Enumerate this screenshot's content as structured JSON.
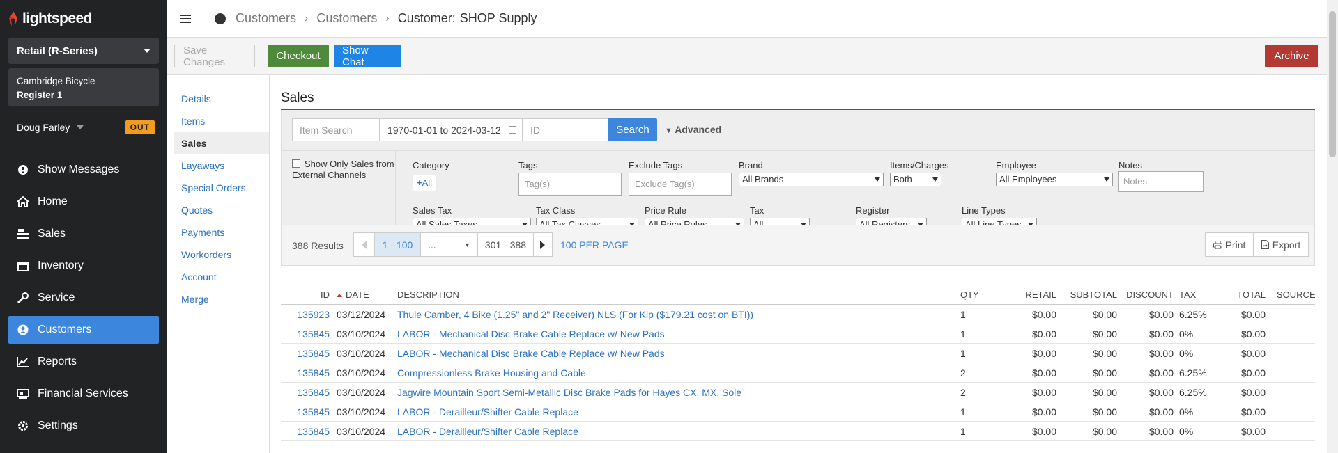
{
  "brand": {
    "name": "lightspeed",
    "accent": "#e8452c"
  },
  "sidebar": {
    "store": "Retail (R-Series)",
    "shop": "Cambridge Bicycle",
    "register": "Register 1",
    "user": "Doug Farley",
    "clock_badge": "OUT",
    "nav": [
      {
        "label": "Show Messages",
        "icon": "info-icon"
      },
      {
        "label": "Home",
        "icon": "home-icon"
      },
      {
        "label": "Sales",
        "icon": "cash-register-icon"
      },
      {
        "label": "Inventory",
        "icon": "barcode-icon"
      },
      {
        "label": "Service",
        "icon": "wrench-icon"
      },
      {
        "label": "Customers",
        "icon": "user-icon",
        "active": true
      },
      {
        "label": "Reports",
        "icon": "chart-line-icon"
      },
      {
        "label": "Financial Services",
        "icon": "bank-icon"
      },
      {
        "label": "Settings",
        "icon": "gear-icon"
      }
    ]
  },
  "header": {
    "breadcrumbs": [
      "Customers",
      "Customers"
    ],
    "current_prefix": "Customer:",
    "current_name": "SHOP Supply"
  },
  "toolbar": {
    "save_label": "Save Changes",
    "checkout_label": "Checkout",
    "chat_label": "Show Chat",
    "archive_label": "Archive"
  },
  "subnav": [
    "Details",
    "Items",
    "Sales",
    "Layaways",
    "Special Orders",
    "Quotes",
    "Payments",
    "Workorders",
    "Account",
    "Merge"
  ],
  "subnav_active": "Sales",
  "main": {
    "title": "Sales"
  },
  "search": {
    "item_placeholder": "Item Search",
    "date_range": "1970-01-01 to 2024-03-12",
    "id_placeholder": "ID",
    "button": "Search",
    "advanced": "Advanced"
  },
  "filters": {
    "external_only_label": "Show Only Sales from External Channels",
    "category_label": "Category",
    "category_button": "All",
    "tags_label": "Tags",
    "tags_placeholder": "Tag(s)",
    "exclude_tags_label": "Exclude Tags",
    "exclude_tags_placeholder": "Exclude Tag(s)",
    "brand_label": "Brand",
    "brand_value": "All Brands",
    "items_charges_label": "Items/Charges",
    "items_charges_value": "Both",
    "employee_label": "Employee",
    "employee_value": "All Employees",
    "notes_label": "Notes",
    "notes_placeholder": "Notes",
    "sales_tax_label": "Sales Tax",
    "sales_tax_value": "All Sales Taxes",
    "tax_class_label": "Tax Class",
    "tax_class_value": "All Tax Classes",
    "price_rule_label": "Price Rule",
    "price_rule_value": "All Price Rules",
    "tax_label": "Tax",
    "tax_value": "All",
    "register_label": "Register",
    "register_value": "All Registers",
    "line_types_label": "Line Types",
    "line_types_value": "All Line Types"
  },
  "results": {
    "count": "388 Results",
    "page_current": "1 - 100",
    "page_ellipsis": "...",
    "page_last": "301 - 388",
    "per_page": "100 PER PAGE",
    "print": "Print",
    "export": "Export"
  },
  "table": {
    "columns": [
      "ID",
      "DATE",
      "DESCRIPTION",
      "QTY",
      "RETAIL",
      "SUBTOTAL",
      "DISCOUNT",
      "TAX",
      "TOTAL",
      "SOURCE"
    ],
    "rows": [
      [
        "135923",
        "03/12/2024",
        "Thule Camber, 4 Bike (1.25\" and 2\" Receiver) NLS (For Kip ($179.21 cost on BTI))",
        "1",
        "$0.00",
        "$0.00",
        "$0.00",
        "6.25%",
        "$0.00",
        ""
      ],
      [
        "135845",
        "03/10/2024",
        "LABOR - Mechanical Disc Brake Cable Replace w/ New Pads",
        "1",
        "$0.00",
        "$0.00",
        "$0.00",
        "0%",
        "$0.00",
        ""
      ],
      [
        "135845",
        "03/10/2024",
        "LABOR - Mechanical Disc Brake Cable Replace w/ New Pads",
        "1",
        "$0.00",
        "$0.00",
        "$0.00",
        "0%",
        "$0.00",
        ""
      ],
      [
        "135845",
        "03/10/2024",
        "Compressionless Brake Housing and Cable",
        "2",
        "$0.00",
        "$0.00",
        "$0.00",
        "6.25%",
        "$0.00",
        ""
      ],
      [
        "135845",
        "03/10/2024",
        "Jagwire Mountain Sport Semi-Metallic Disc Brake Pads for Hayes CX, MX, Sole",
        "2",
        "$0.00",
        "$0.00",
        "$0.00",
        "6.25%",
        "$0.00",
        ""
      ],
      [
        "135845",
        "03/10/2024",
        "LABOR - Derailleur/Shifter Cable Replace",
        "1",
        "$0.00",
        "$0.00",
        "$0.00",
        "0%",
        "$0.00",
        ""
      ],
      [
        "135845",
        "03/10/2024",
        "LABOR - Derailleur/Shifter Cable Replace",
        "1",
        "$0.00",
        "$0.00",
        "$0.00",
        "0%",
        "$0.00",
        ""
      ]
    ]
  }
}
